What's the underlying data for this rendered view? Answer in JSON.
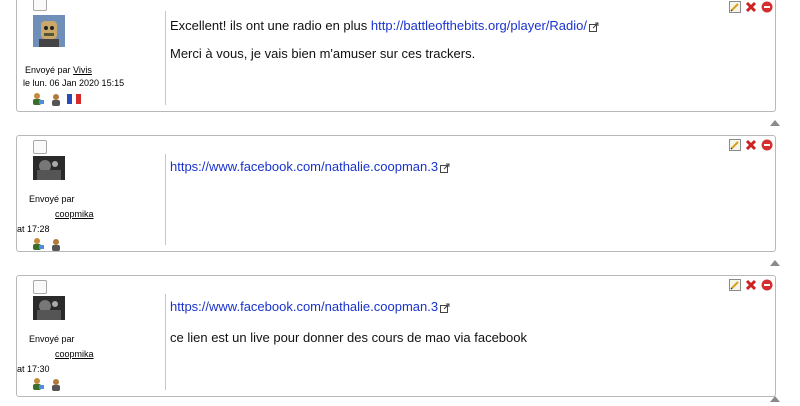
{
  "posts": [
    {
      "author_prefix": "Envoyé par",
      "author": "Vivis",
      "date": "le lun. 06 Jan 2020 15:15",
      "has_flag": true,
      "lines": [
        {
          "text": "Excellent! ils ont une radio en plus ",
          "link": "http://battleofthebits.org/player/Radio/"
        },
        {
          "text": "Merci à vous, je vais bien m'amuser sur ces trackers.",
          "link": ""
        }
      ]
    },
    {
      "author_prefix": "Envoyé par",
      "author": "coopmika",
      "date": "at 17:28",
      "has_flag": false,
      "lines": [
        {
          "text": "",
          "link": "https://www.facebook.com/nathalie.coopman.3"
        }
      ]
    },
    {
      "author_prefix": "Envoyé par",
      "author": "coopmika",
      "date": "at 17:30",
      "has_flag": false,
      "lines": [
        {
          "text": "",
          "link": "https://www.facebook.com/nathalie.coopman.3"
        },
        {
          "text": "ce lien est un live pour donner des cours de mao via facebook",
          "link": ""
        }
      ]
    }
  ],
  "icons": {
    "edit": "edit-icon",
    "delete": "delete-icon",
    "remove": "remove-icon",
    "top": "scroll-top-icon",
    "profile": "user-profile-icon",
    "message": "user-message-icon",
    "flag": "french-flag-icon",
    "external": "external-link-icon"
  },
  "colors": {
    "link": "#1a33cc",
    "delete_red": "#cc2222",
    "border": "#b8b8b8"
  }
}
